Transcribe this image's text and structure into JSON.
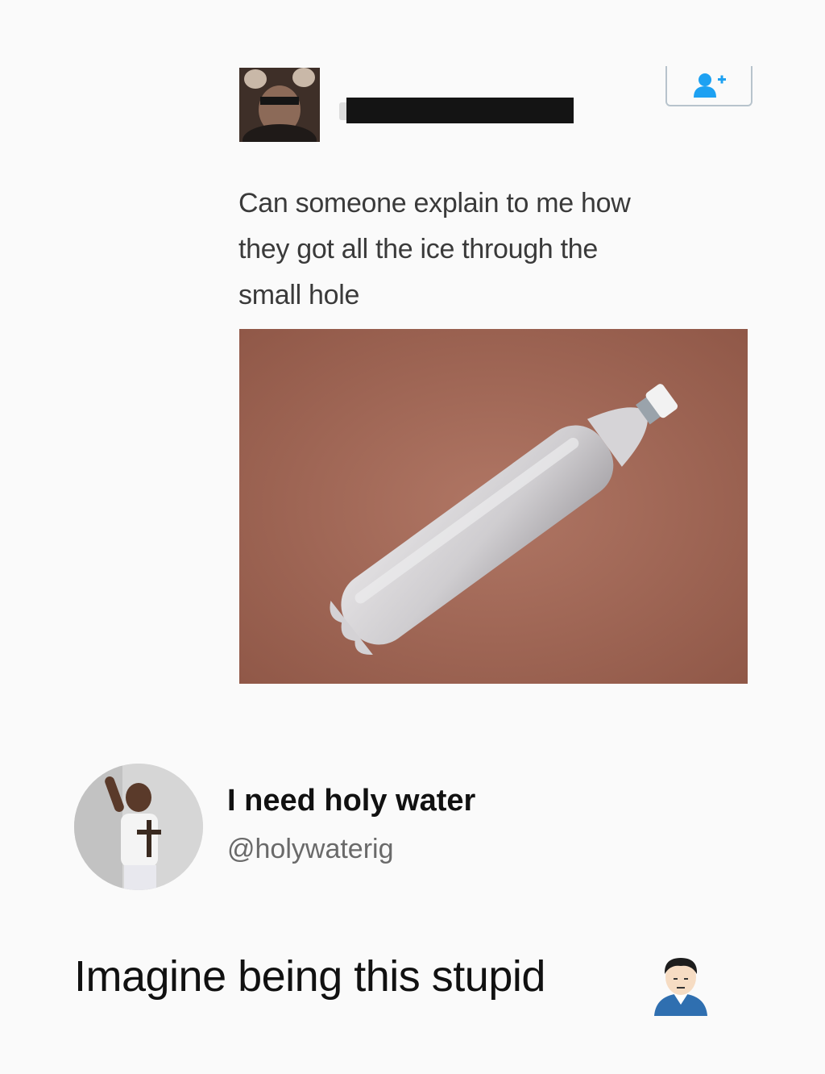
{
  "original_tweet": {
    "text_lines": [
      "Can someone explain to me how",
      "they got all the ice through the",
      "small hole"
    ],
    "icons": {
      "avatar": "user-photo",
      "follow": "follow-person-plus-icon",
      "name": "redacted-name-bar",
      "photo": "frozen-bottle-photo"
    }
  },
  "reply": {
    "display_name": "I need holy water",
    "handle": "@holywaterig",
    "caption": "Imagine being this stupid",
    "icons": {
      "avatar": "user-photo",
      "emoji": "man-facepalm-emoji"
    }
  },
  "colors": {
    "background": "#fafafa",
    "photo_background": "#a66a57",
    "follow_icon": "#1da1f2"
  }
}
